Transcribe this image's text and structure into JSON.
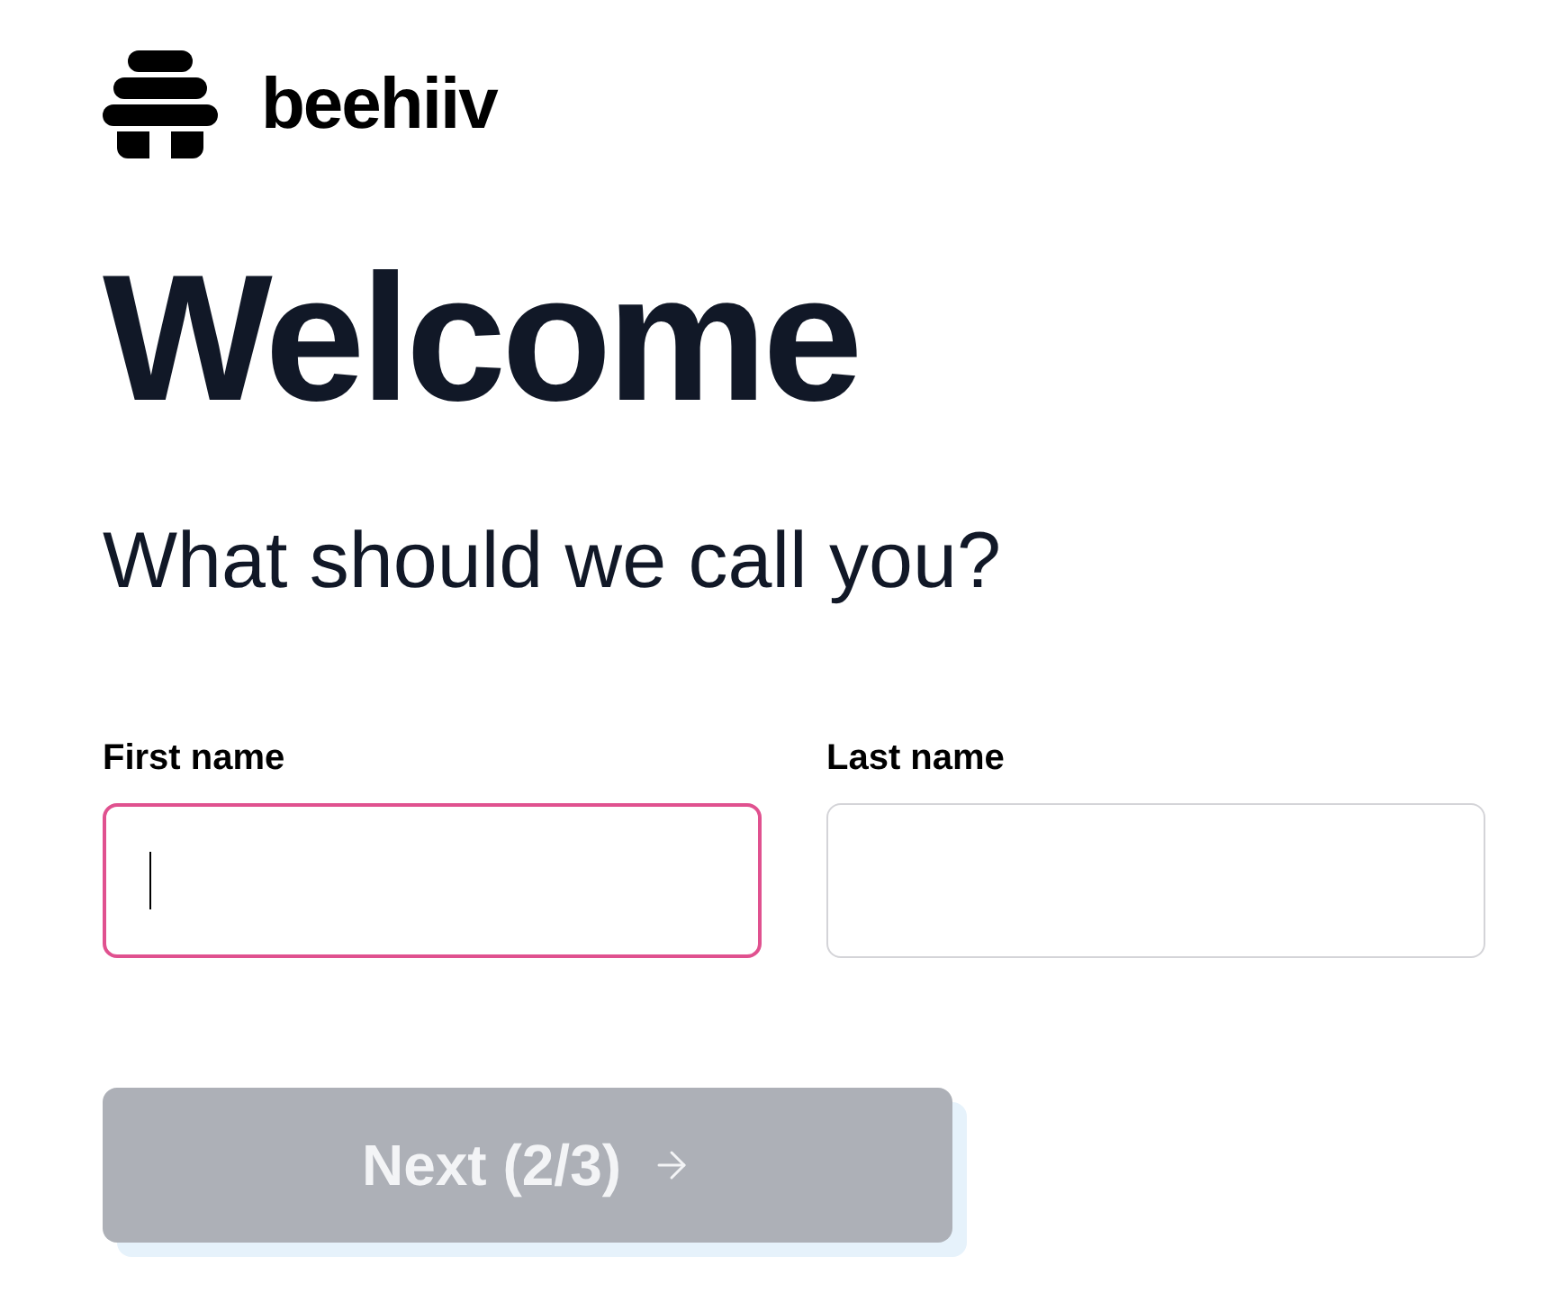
{
  "logo": {
    "name": "beehiiv"
  },
  "heading": "Welcome",
  "subheading": "What should we call you?",
  "fields": [
    {
      "label": "First name",
      "focused": true
    },
    {
      "label": "Last name",
      "focused": false
    }
  ],
  "next_button": {
    "label": "Next (2/3)",
    "disabled": true
  }
}
